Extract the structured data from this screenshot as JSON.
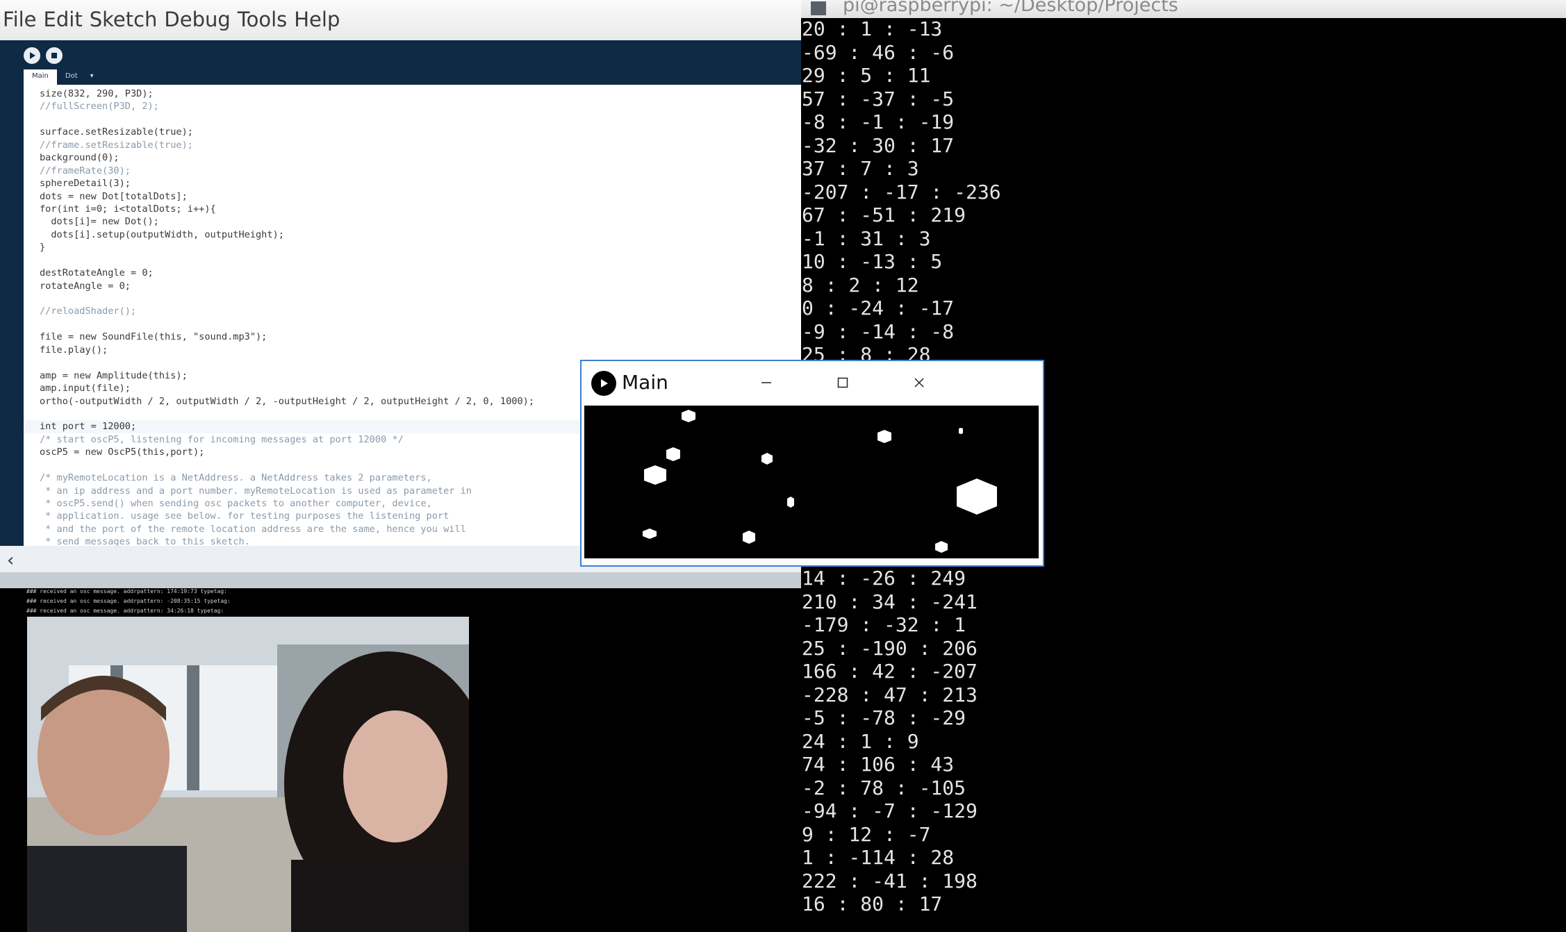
{
  "ide": {
    "menu": [
      "File",
      "Edit",
      "Sketch",
      "Debug",
      "Tools",
      "Help"
    ],
    "tabs": {
      "main": "Main",
      "dot": "Dot",
      "more": "▾"
    },
    "code": [
      "size(832, 290, P3D);",
      "//fullScreen(P3D, 2);",
      "",
      "surface.setResizable(true);",
      "//frame.setResizable(true);",
      "background(0);",
      "//frameRate(30);",
      "sphereDetail(3);",
      "dots = new Dot[totalDots];",
      "for(int i=0; i<totalDots; i++){",
      "  dots[i]= new Dot();",
      "  dots[i].setup(outputWidth, outputHeight);",
      "}",
      "",
      "destRotateAngle = 0;",
      "rotateAngle = 0;",
      "",
      "//reloadShader();",
      "",
      "file = new SoundFile(this, \"sound.mp3\");",
      "file.play();",
      "",
      "amp = new Amplitude(this);",
      "amp.input(file);",
      "ortho(-outputWidth / 2, outputWidth / 2, -outputHeight / 2, outputHeight / 2, 0, 1000);",
      "",
      "int port = 12000;",
      "/* start oscP5, listening for incoming messages at port 12000 */",
      "oscP5 = new OscP5(this,port);",
      "",
      "/* myRemoteLocation is a NetAddress. a NetAddress takes 2 parameters,",
      " * an ip address and a port number. myRemoteLocation is used as parameter in",
      " * oscP5.send() when sending osc packets to another computer, device,",
      " * application. usage see below. for testing purposes the listening port",
      " * and the port of the remote location address are the same, hence you will",
      " * send messages back to this sketch."
    ],
    "console": [
      "### received an osc message. addrpattern: 174:19:73 typetag:",
      "### received an osc message. addrpattern: -208:35:15 typetag:",
      "### received an osc message. addrpattern: 34:26:18 typetag:"
    ]
  },
  "terminal": {
    "title": "pi@raspberrypi: ~/Desktop/Projects",
    "lines_top": [
      "20 : 1 : -13",
      "-69 : 46 : -6",
      "29 : 5 : 11",
      "57 : -37 : -5",
      "-8 : -1 : -19",
      "-32 : 30 : 17",
      "37 : 7 : 3",
      "-207 : -17 : -236",
      "67 : -51 : 219",
      "-1 : 31 : 3",
      "10 : -13 : 5",
      "8 : 2 : 12",
      "0 : -24 : -17",
      "-9 : -14 : -8",
      "25 : 8 : 28"
    ],
    "lines_bottom": [
      "14 : -26 : 249",
      "210 : 34 : -241",
      "-179 : -32 : 1",
      "25 : -190 : 206",
      "166 : 42 : -207",
      "-228 : 47 : 213",
      "-5 : -78 : -29",
      "24 : 1 : 9",
      "74 : 106 : 43",
      "-2 : 78 : -105",
      "-94 : -7 : -129",
      "9 : 12 : -7",
      "1 : -114 : 28",
      "222 : -41 : 198",
      "16 : 80 : 17"
    ]
  },
  "sketch": {
    "title": "Main",
    "icon": "play-icon"
  },
  "colors": {
    "ide_toolbar": "#0e2a45",
    "window_border": "#3c7fd4"
  }
}
